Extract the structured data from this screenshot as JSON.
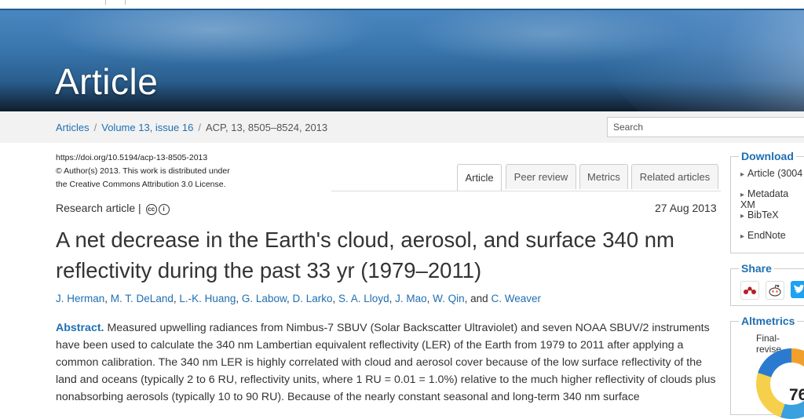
{
  "banner": {
    "title": "Article"
  },
  "breadcrumb": {
    "articles": "Articles",
    "sep": "/",
    "volume": "Volume 13, issue 16",
    "citation": "ACP, 13, 8505–8524, 2013"
  },
  "search": {
    "placeholder": "Search"
  },
  "doi_block": {
    "doi": "https://doi.org/10.5194/acp-13-8505-2013",
    "copyright": "© Author(s) 2013. This work is distributed under",
    "license": "the Creative Commons Attribution 3.0 License."
  },
  "tabs": [
    "Article",
    "Peer review",
    "Metrics",
    "Related articles"
  ],
  "article": {
    "type": "Research article |",
    "date": "27 Aug 2013",
    "title_line1": "A net decrease in the Earth's cloud, aerosol, and surface 340 nm",
    "title_line2": "reflectivity during the past 33 yr (1979–2011)",
    "authors": [
      "J. Herman",
      "M. T. DeLand",
      "L.-K. Huang",
      "G. Labow",
      "D. Larko",
      "S. A. Lloyd",
      "J. Mao",
      "W. Qin",
      "C. Weaver"
    ],
    "authors_and": "and",
    "abstract_label": "Abstract.",
    "abstract_text": "Measured upwelling radiances from Nimbus-7 SBUV (Solar Backscatter Ultraviolet) and seven NOAA SBUV/2 instruments have been used to calculate the 340 nm Lambertian equivalent reflectivity (LER) of the Earth from 1979 to 2011 after applying a common calibration. The 340 nm LER is highly correlated with cloud and aerosol cover because of the low surface reflectivity of the land and oceans (typically 2 to 6 RU, reflectivity units, where 1 RU = 0.01 = 1.0%) relative to the much higher reflectivity of clouds plus nonabsorbing aerosols (typically 10 to 90 RU). Because of the nearly constant seasonal and long-term 340 nm surface"
  },
  "sidebar": {
    "download": {
      "heading": "Download",
      "items": [
        "Article (3004",
        "Metadata XM",
        "BibTeX",
        "EndNote"
      ]
    },
    "share": {
      "heading": "Share"
    },
    "altmetrics": {
      "heading": "Altmetrics",
      "caption": "Final-revise",
      "score": "76"
    }
  },
  "colors": {
    "link": "#1f6fb2",
    "banner_dark": "#0f1d2c"
  },
  "icons": [
    "mendeley-icon",
    "reddit-icon",
    "twitter-icon",
    "creative-commons-icon"
  ]
}
